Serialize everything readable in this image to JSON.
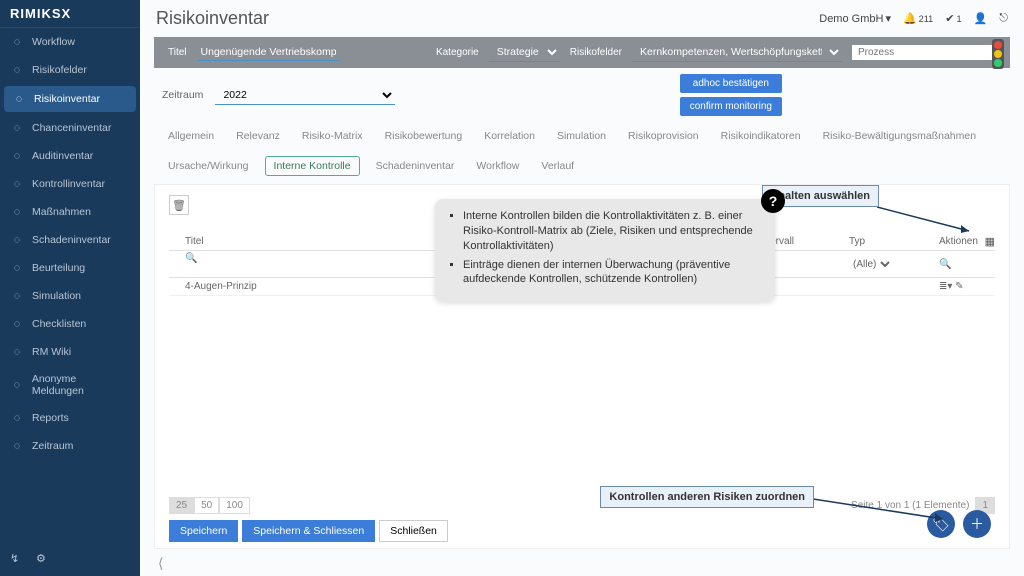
{
  "brand": "RIMIKS",
  "brand_x": "X",
  "sidebar": {
    "items": [
      "Workflow",
      "Risikofelder",
      "Risikoinventar",
      "Chanceninventar",
      "Auditinventar",
      "Kontrollinventar",
      "Maßnahmen",
      "Schadeninventar",
      "Beurteilung",
      "Simulation",
      "Checklisten",
      "RM Wiki",
      "Anonyme Meldungen",
      "Reports",
      "Zeitraum"
    ],
    "active_index": 2
  },
  "header": {
    "page_title": "Risikoinventar",
    "org": "Demo GmbH",
    "notif_count": "211",
    "check_count": "1"
  },
  "meta": {
    "title_label": "Titel",
    "title_value": "Ungenügende Vertriebskompetenz",
    "kat_label": "Kategorie",
    "kat_value": "Strategie",
    "rf_label": "Risikofelder",
    "rf_value": "Kernkompetenzen, Wertschöpfungskette",
    "prozess_label": "Prozess"
  },
  "period": {
    "label": "Zeitraum",
    "value": "2022",
    "btn_adhoc": "adhoc bestätigen",
    "btn_confirm": "confirm monitoring"
  },
  "tabs": {
    "items": [
      "Allgemein",
      "Relevanz",
      "Risiko-Matrix",
      "Risikobewertung",
      "Korrelation",
      "Simulation",
      "Risikoprovision",
      "Risikoindikatoren",
      "Risiko-Bewältigungsmaßnahmen",
      "Ursache/Wirkung",
      "Interne Kontrolle",
      "Schadeninventar",
      "Workflow",
      "Verlauf"
    ],
    "active_index": 10
  },
  "callout": {
    "li1": "Interne Kontrollen bilden die Kontrollaktivitäten z. B. einer Risiko-Kontroll-Matrix ab (Ziele, Risiken und entsprechende Kontrollaktivitäten)",
    "li2": "Einträge dienen der internen Überwachung (präventive aufdeckende Kontrollen, schützende Kontrollen)"
  },
  "annot": {
    "cols": "Spalten auswählen",
    "assign": "Kontrollen anderen Risiken zuordnen"
  },
  "table": {
    "cols": {
      "title": "Titel",
      "intervall": "Intervall",
      "typ": "Typ",
      "aktionen": "Aktionen"
    },
    "typ_all": "(Alle)",
    "row1_title": "4-Augen-Prinzip"
  },
  "pager": {
    "sizes": [
      "25",
      "50",
      "100"
    ],
    "info": "Seite 1 von 1 (1 Elemente)",
    "page": "1"
  },
  "buttons": {
    "save": "Speichern",
    "save_close": "Speichern & Schliessen",
    "close": "Schließen"
  }
}
